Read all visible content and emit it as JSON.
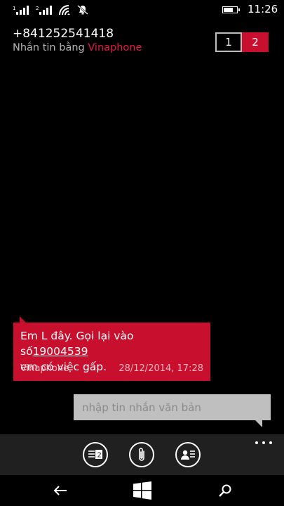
{
  "status_bar": {
    "sim1_label": "1",
    "sim2_label": "2",
    "time": "11:26",
    "battery_level": 0.75
  },
  "header": {
    "contact_number": "+841252541418",
    "sending_via_prefix": "Nhắn tin bằng ",
    "carrier": "Vinaphone"
  },
  "sim_switch": {
    "sim1": "1",
    "sim2": "2",
    "selected": "2"
  },
  "message": {
    "text_before": "Em L đây. Gọi lại vào số",
    "phone": "19004539",
    "text_after": "em có việc gấp.",
    "sender": "Vinaphone",
    "timestamp": "28/12/2014, 17:28"
  },
  "compose": {
    "placeholder": "nhập tin nhắn văn bản"
  },
  "app_bar": {
    "sim_badge": "2",
    "buttons": [
      "switch-sim",
      "attach",
      "contact-card"
    ]
  },
  "colors": {
    "accent": "#c8102e",
    "carrier_text": "#e51a46",
    "compose_bg": "#bfbfbf",
    "app_bar_bg": "#202020"
  }
}
